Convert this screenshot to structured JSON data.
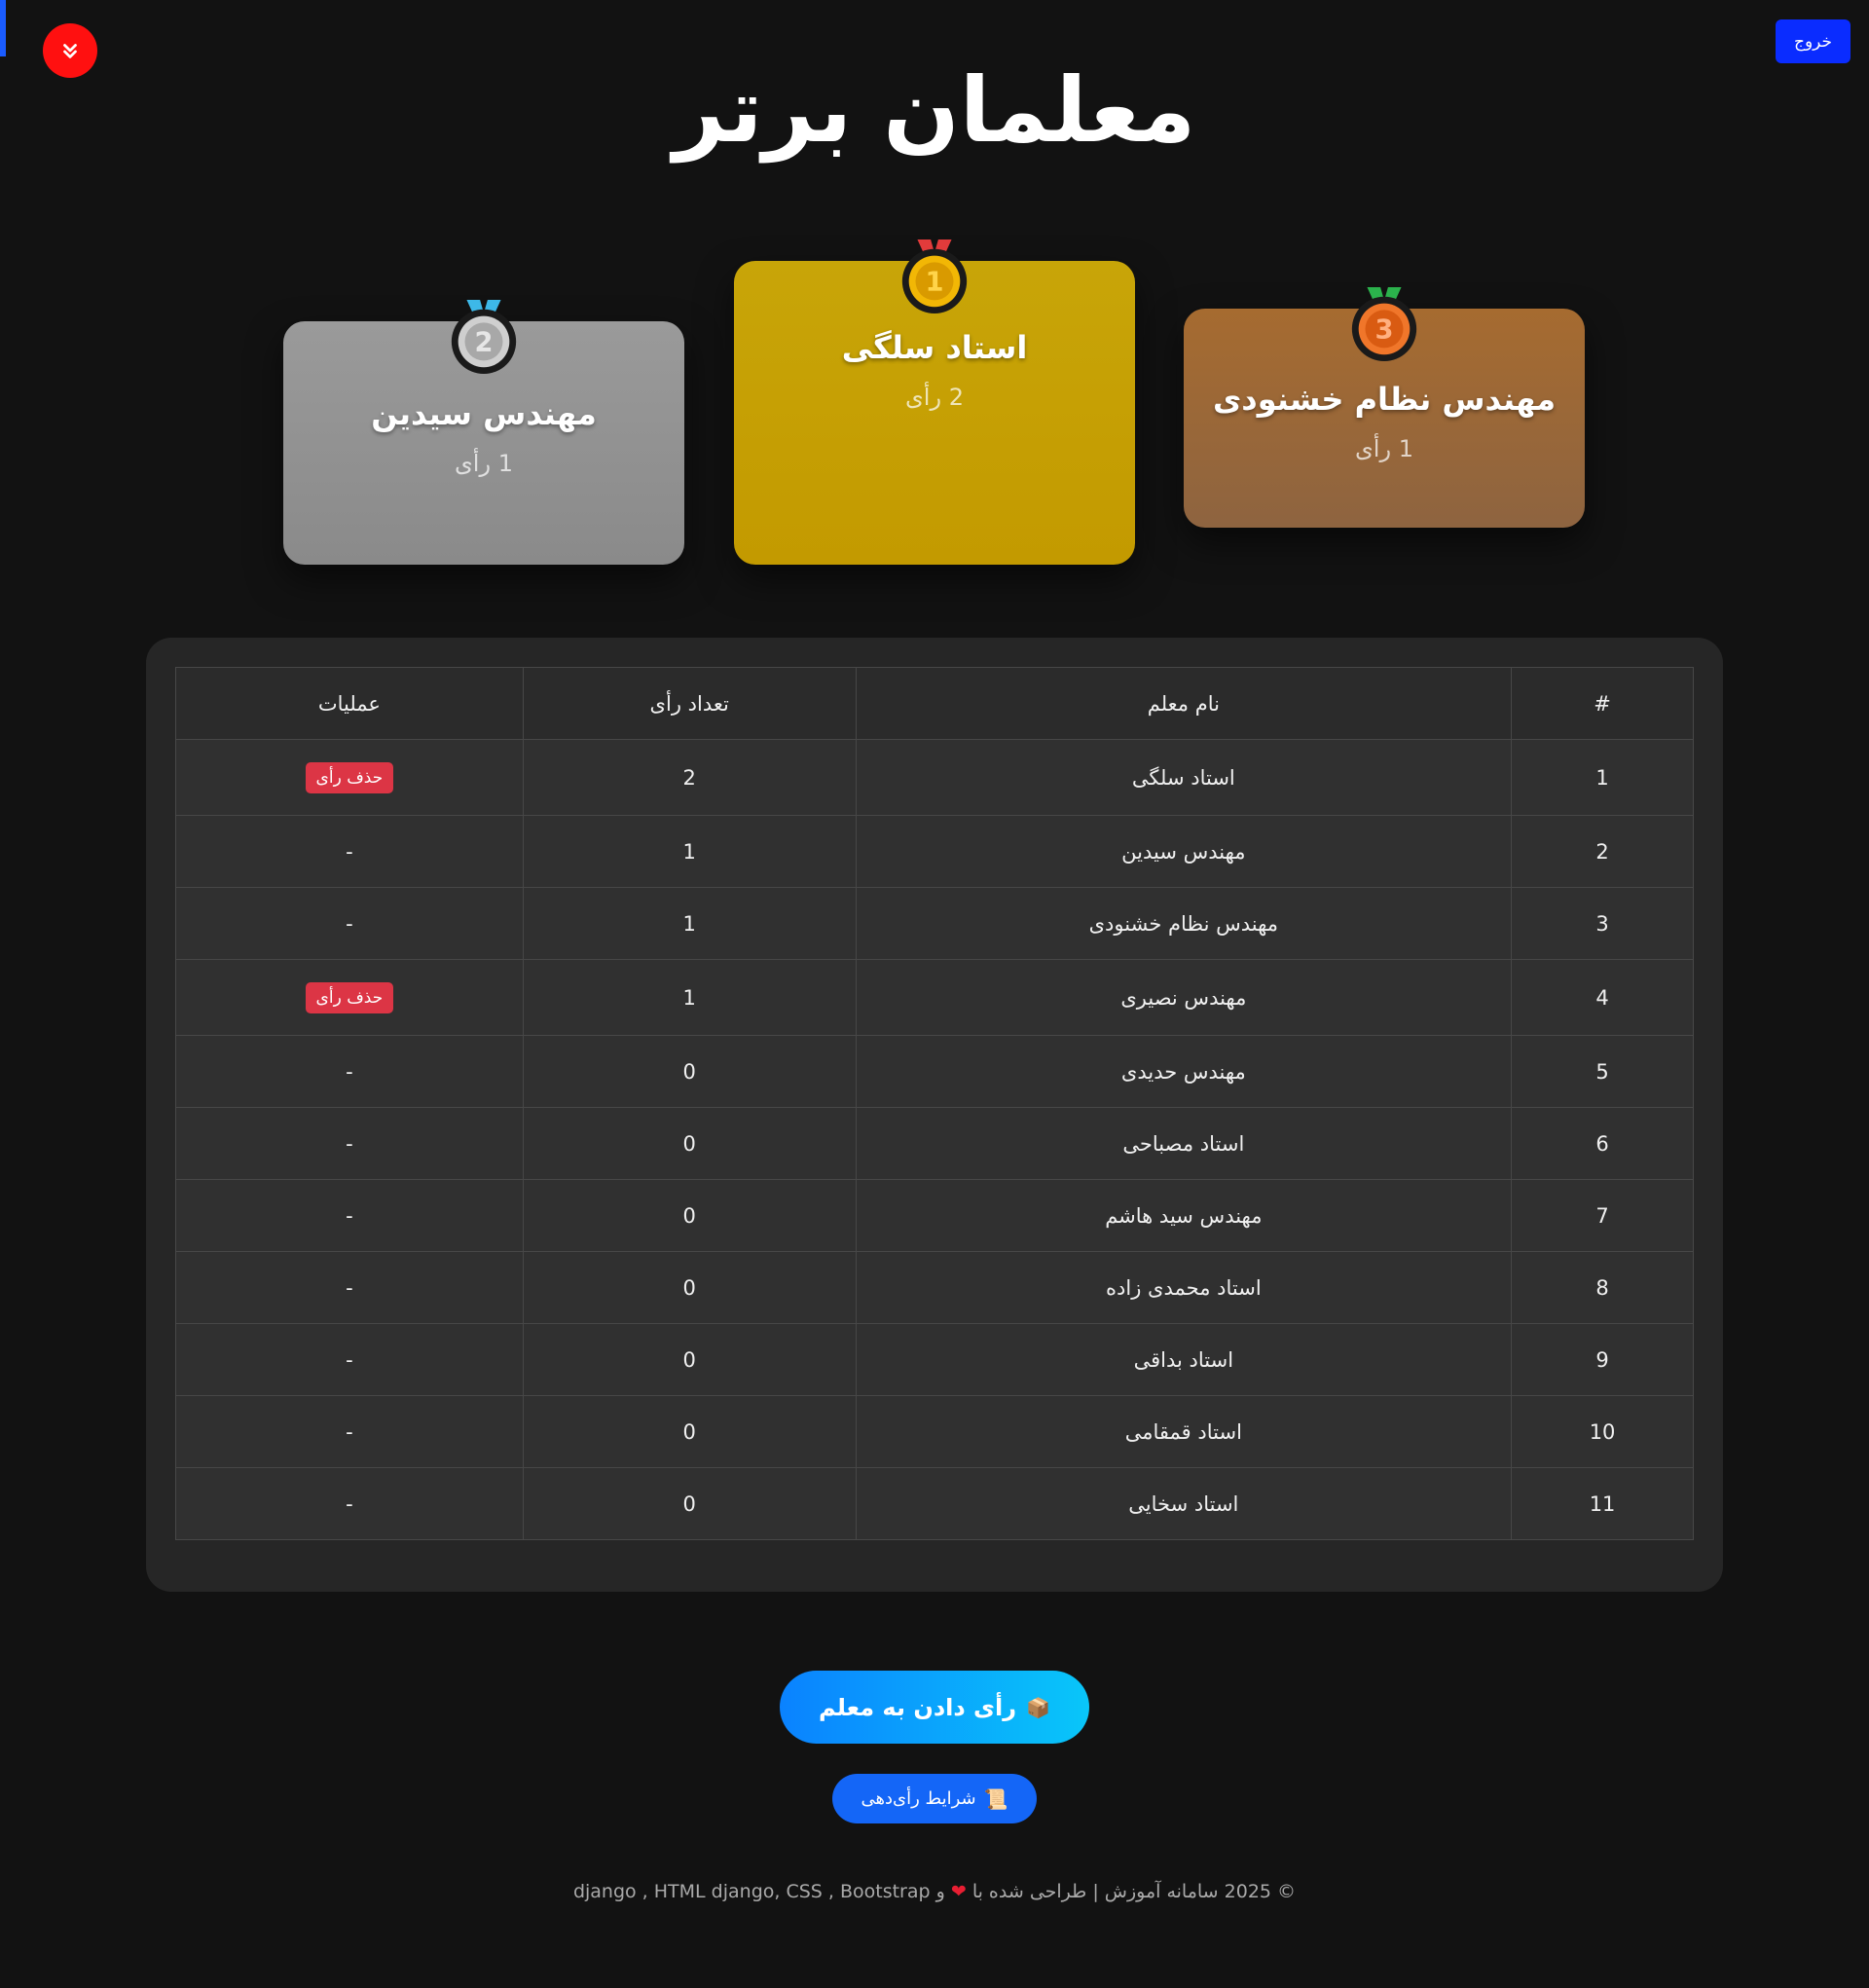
{
  "header": {
    "logout_label": "خروج",
    "title": "معلمان برتر"
  },
  "podium": [
    {
      "rank": "1",
      "name": "استاد سلگی",
      "votes": "2 رأی",
      "medal_color": "#f2b705"
    },
    {
      "rank": "2",
      "name": "مهندس سیدین",
      "votes": "1 رأی",
      "medal_color": "#b9b9b9"
    },
    {
      "rank": "3",
      "name": "مهندس نظام خشنودی",
      "votes": "1 رأی",
      "medal_color": "#f0762a"
    }
  ],
  "table": {
    "headers": [
      "#",
      "نام معلم",
      "تعداد رأی",
      "عملیات"
    ],
    "delete_label": "حذف رأی",
    "empty_ops": "-",
    "rows": [
      {
        "num": "1",
        "name": "استاد سلگی",
        "votes": "2",
        "ops": "حذف رأی"
      },
      {
        "num": "2",
        "name": "مهندس سیدین",
        "votes": "1",
        "ops": "-"
      },
      {
        "num": "3",
        "name": "مهندس نظام خشنودی",
        "votes": "1",
        "ops": "-"
      },
      {
        "num": "4",
        "name": "مهندس نصیری",
        "votes": "1",
        "ops": "حذف رأی"
      },
      {
        "num": "5",
        "name": "مهندس حدیدی",
        "votes": "0",
        "ops": "-"
      },
      {
        "num": "6",
        "name": "استاد مصباحی",
        "votes": "0",
        "ops": "-"
      },
      {
        "num": "7",
        "name": "مهندس سید هاشم",
        "votes": "0",
        "ops": "-"
      },
      {
        "num": "8",
        "name": "استاد محمدی زاده",
        "votes": "0",
        "ops": "-"
      },
      {
        "num": "9",
        "name": "استاد بداقی",
        "votes": "0",
        "ops": "-"
      },
      {
        "num": "10",
        "name": "استاد قمقامی",
        "votes": "0",
        "ops": "-"
      },
      {
        "num": "11",
        "name": "استاد سخایی",
        "votes": "0",
        "ops": "-"
      }
    ]
  },
  "actions": {
    "vote_label": "رأی دادن به معلم",
    "vote_icon": "ballot-box-icon",
    "rules_label": "شرایط رأی‌دهی",
    "rules_icon": "scroll-icon"
  },
  "footer": {
    "text_before_heart": "© 2025 سامانه آموزش | طراحی شده با",
    "text_after_heart": "و django , HTML django, CSS , Bootstrap"
  },
  "colors": {
    "background": "#121212",
    "logout": "#0a2cff",
    "scroll_button": "#ff1010",
    "delete": "#dc3545",
    "gold_card": "#c39a00",
    "silver_card": "#8f8f8f",
    "bronze_card": "#9a6838"
  }
}
